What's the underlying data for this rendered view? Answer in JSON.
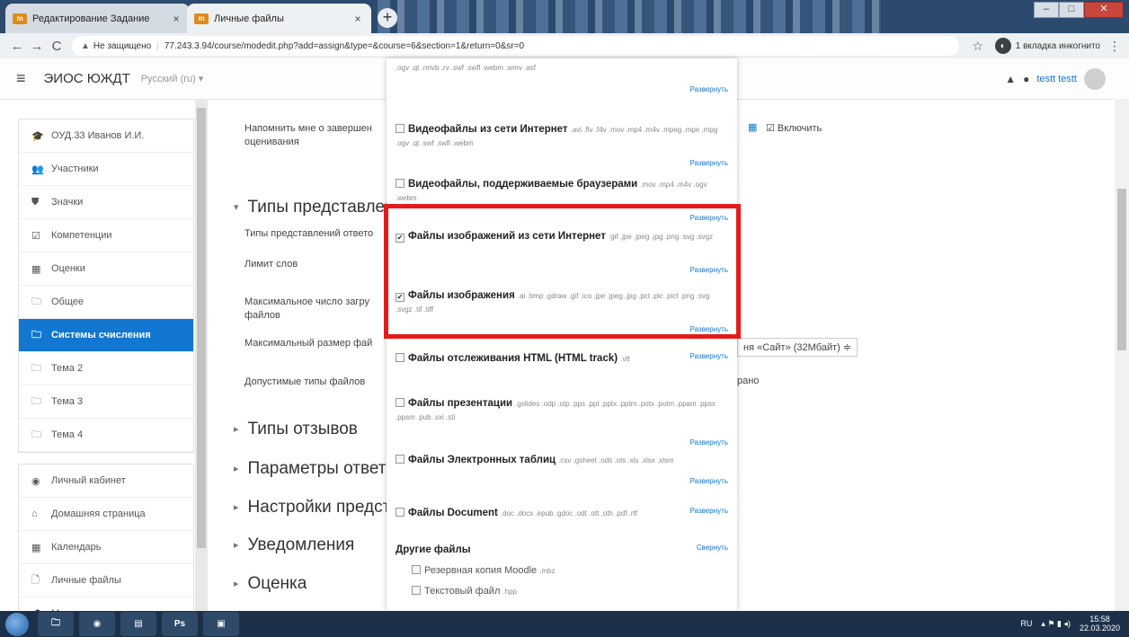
{
  "browser": {
    "tabs": [
      {
        "title": "Редактирование Задание",
        "close": "×"
      },
      {
        "title": "Личные файлы",
        "close": "×"
      }
    ],
    "new_tab": "+",
    "window_buttons": {
      "minimize": "–",
      "maximize": "□",
      "close": "✕"
    },
    "nav": {
      "back": "←",
      "forward": "→",
      "reload": "C"
    },
    "security_icon": "▲",
    "security_text": "Не защищено",
    "url_separator": "|",
    "url": "77.243.3.94/course/modedit.php?add=assign&type=&course=6&section=1&return=0&sr=0",
    "star": "☆",
    "incognito_text": "1 вкладка инкогнито",
    "menu": "⋮"
  },
  "moodle": {
    "hamburger": "≡",
    "brand": "ЭИОС ЮЖДТ",
    "language": "Русский (ru) ▾",
    "user_name": "testt testt"
  },
  "sidebar": {
    "course_block": [
      {
        "icon": "graduation-cap-icon",
        "glyph": "🎓",
        "label": "ОУД.33 Иванов И.И."
      },
      {
        "icon": "users-icon",
        "glyph": "👥",
        "label": "Участники"
      },
      {
        "icon": "shield-icon",
        "glyph": "⛊",
        "label": "Значки"
      },
      {
        "icon": "checkbox-icon",
        "glyph": "☑",
        "label": "Компетенции"
      },
      {
        "icon": "table-icon",
        "glyph": "▦",
        "label": "Оценки"
      },
      {
        "icon": "folder-icon",
        "glyph": "🗀",
        "label": "Общее"
      },
      {
        "icon": "folder-icon",
        "glyph": "🗀",
        "label": "Системы счисления",
        "active": true
      },
      {
        "icon": "folder-icon",
        "glyph": "🗀",
        "label": "Тема 2"
      },
      {
        "icon": "folder-icon",
        "glyph": "🗀",
        "label": "Тема 3"
      },
      {
        "icon": "folder-icon",
        "glyph": "🗀",
        "label": "Тема 4"
      }
    ],
    "site_block": [
      {
        "icon": "dashboard-icon",
        "glyph": "◉",
        "label": "Личный кабинет"
      },
      {
        "icon": "home-icon",
        "glyph": "⌂",
        "label": "Домашняя страница"
      },
      {
        "icon": "calendar-icon",
        "glyph": "▦",
        "label": "Календарь"
      },
      {
        "icon": "file-icon",
        "glyph": "🗋",
        "label": "Личные файлы"
      },
      {
        "icon": "graduation-cap-icon",
        "glyph": "🎓",
        "label": "Мои курсы"
      }
    ]
  },
  "main": {
    "remind_label": "Напомнить мне о завершен оценивания",
    "calendar_glyph": "▦",
    "enable_label": "☑ Включить",
    "submission_types_heading": "Типы представлен",
    "submission_types_label": "Типы представлений ответо",
    "word_limit_label": "Лимит слов",
    "max_files_label": "Максимальное число загру файлов",
    "max_size_label": "Максимальный размер фай",
    "max_size_value": "ня «Сайт» (32Мбайт) ≑",
    "allowed_types_label": "Допустимые типы файлов",
    "allowed_types_value": "рано",
    "sections": [
      "Типы отзывов",
      "Параметры ответа",
      "Настройки предст",
      "Уведомления",
      "Оценка",
      "Об"
    ]
  },
  "dialog": {
    "top_ext": ".ogv .qt .rmvb .rv .swf .swfl .webm .wmv .asf",
    "expand_label": "Развернуть",
    "collapse_label": "Свернуть",
    "groups": [
      {
        "checked": false,
        "name": "Видеофайлы из сети Интернет",
        "ext": ".avi .flv .f4v .mov .mp4 .m4v .mpeg .mpe .mpg .ogv .qt .swf .swfl .webm"
      },
      {
        "checked": false,
        "name": "Видеофайлы, поддерживаемые браузерами",
        "ext": ".mov .mp4 .m4v .ogv .webm"
      },
      {
        "checked": true,
        "name": "Файлы изображений из сети Интернет",
        "ext": ".gif .jpe .jpeg .jpg .png .svg .svgz"
      },
      {
        "checked": true,
        "name": "Файлы изображения",
        "ext": ".ai .bmp .gdraw .gif .ico .jpe .jpeg .jpg .pct .pic .pict .png .svg .svgz .tif .tiff"
      },
      {
        "checked": false,
        "name": "Файлы отслеживания HTML (HTML track)",
        "ext": ".vtt"
      },
      {
        "checked": false,
        "name": "Файлы презентации",
        "ext": ".gslides .odp .otp .pps .ppt .pptx .pptm .potx .potm .ppam .ppsx .ppsm .pub .sxi .sti"
      },
      {
        "checked": false,
        "name": "Файлы Электронных таблиц",
        "ext": ".csv .gsheet .ods .ots .xls .xlsx .xlsm"
      },
      {
        "checked": false,
        "name": "Файлы Document",
        "ext": ".doc .docx .epub .gdoc .odt .ott .oth .pdf .rtf"
      }
    ],
    "other_heading": "Другие файлы",
    "other_items": [
      {
        "name": "Резервная копия Moodle",
        "ext": ".mbz"
      },
      {
        "name": "Текстовый файл",
        "ext": ".hpp"
      }
    ]
  },
  "taskbar": {
    "apps": [
      {
        "icon": "explorer-icon",
        "glyph": "🗀"
      },
      {
        "icon": "chrome-icon",
        "glyph": "◉"
      },
      {
        "icon": "library-icon",
        "glyph": "▤"
      },
      {
        "icon": "photoshop-icon",
        "glyph": "Ps"
      },
      {
        "icon": "computer-icon",
        "glyph": "▣"
      }
    ],
    "lang": "RU",
    "tray": "▴ ⚑ ▮ ◂)",
    "time": "15:58",
    "date": "22.03.2020"
  }
}
